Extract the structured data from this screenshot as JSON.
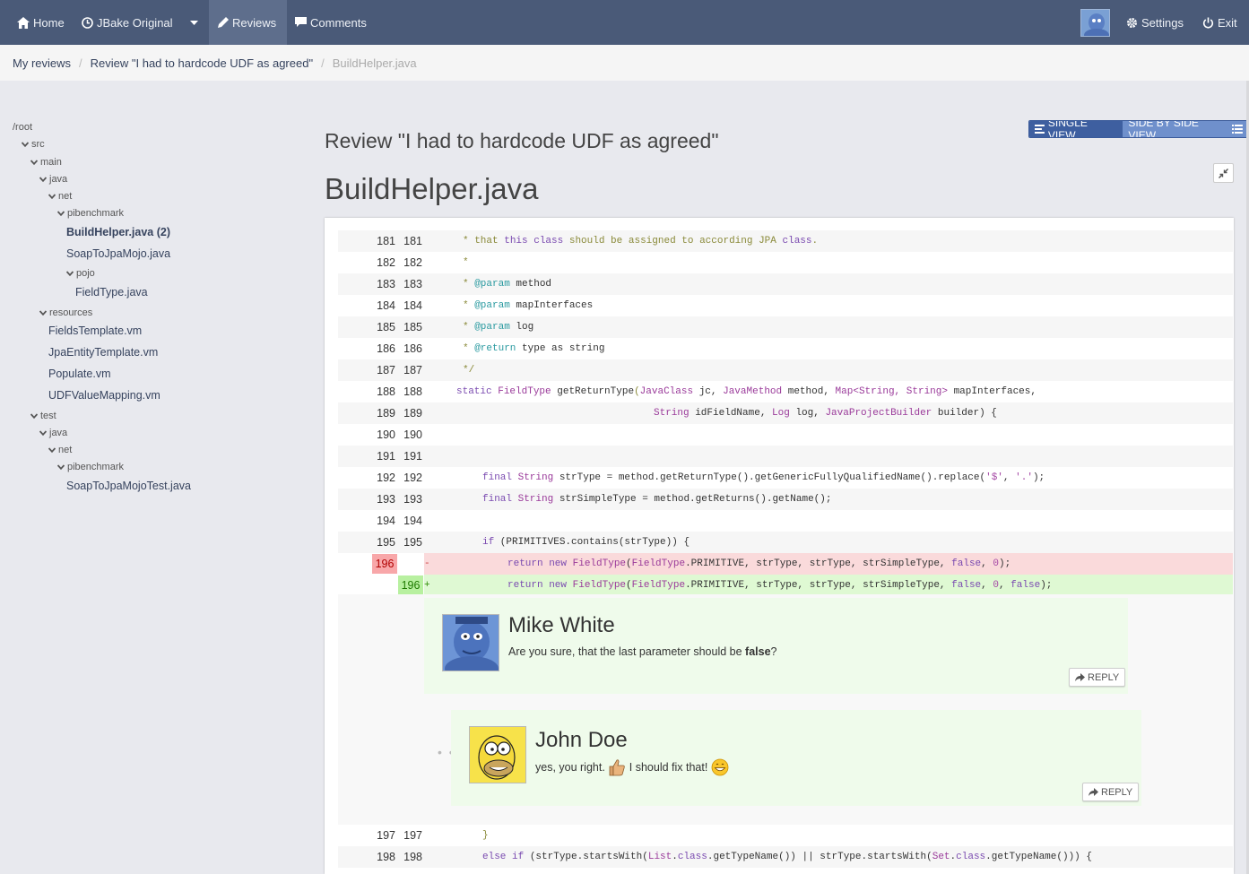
{
  "nav": {
    "home": "Home",
    "project": "JBake Original",
    "reviews": "Reviews",
    "comments": "Comments",
    "settings": "Settings",
    "exit": "Exit"
  },
  "breadcrumb": {
    "my_reviews": "My reviews",
    "review": "Review \"I had to hardcode UDF as agreed\"",
    "file": "BuildHelper.java"
  },
  "tree": {
    "root": "/root",
    "src": "src",
    "main": "main",
    "java": "java",
    "net": "net",
    "pibenchmark": "pibenchmark",
    "build_helper": "BuildHelper.java (2)",
    "soap_to_jpa": "SoapToJpaMojo.java",
    "pojo": "pojo",
    "field_type": "FieldType.java",
    "resources": "resources",
    "fields_template": "FieldsTemplate.vm",
    "jpa_entity": "JpaEntityTemplate.vm",
    "populate": "Populate.vm",
    "udf_value": "UDFValueMapping.vm",
    "test": "test",
    "test_java": "java",
    "test_net": "net",
    "test_pibenchmark": "pibenchmark",
    "soap_test": "SoapToJpaMojoTest.java"
  },
  "main": {
    "review_title": "Review \"I had to hardcode UDF as agreed\"",
    "file_title": "BuildHelper.java",
    "single_view": "SINGLE VIEW",
    "side_view": "SIDE BY SIDE VIEW"
  },
  "lines": [
    {
      "old": "181",
      "new": "181"
    },
    {
      "old": "182",
      "new": "182"
    },
    {
      "old": "183",
      "new": "183"
    },
    {
      "old": "184",
      "new": "184"
    },
    {
      "old": "185",
      "new": "185"
    },
    {
      "old": "186",
      "new": "186"
    },
    {
      "old": "187",
      "new": "187"
    },
    {
      "old": "188",
      "new": "188"
    },
    {
      "old": "189",
      "new": "189"
    },
    {
      "old": "190",
      "new": "190"
    },
    {
      "old": "191",
      "new": "191"
    },
    {
      "old": "192",
      "new": "192"
    },
    {
      "old": "193",
      "new": "193"
    },
    {
      "old": "194",
      "new": "194"
    },
    {
      "old": "195",
      "new": "195"
    },
    {
      "del": "196",
      "marker": "-"
    },
    {
      "add": "196",
      "marker": "+"
    },
    {
      "old": "197",
      "new": "197"
    },
    {
      "old": "198",
      "new": "198"
    }
  ],
  "code": {
    "l181a": "* that ",
    "l181b": "this",
    "l181c": " ",
    "l181d": "class",
    "l181e": " should be assigned to according JPA ",
    "l181f": "class",
    "l181g": ".",
    "l182": "*",
    "l183a": "* ",
    "l183b": "@param",
    "l183c": " method",
    "l184a": "* ",
    "l184b": "@param",
    "l184c": " mapInterfaces",
    "l185a": "* ",
    "l185b": "@param",
    "l185c": " log",
    "l186a": "* ",
    "l186b": "@return",
    "l186c": " type as string",
    "l187": "*/",
    "l188a": "static ",
    "l188b": "FieldType",
    "l188c": " getReturnType",
    "l188d": "(",
    "l188e": "JavaClass",
    "l188f": " jc, ",
    "l188g": "JavaMethod",
    "l188h": " method, ",
    "l188i": "Map<String, String>",
    "l188j": " mapInterfaces,",
    "l189a": "String",
    "l189b": " idFieldName, ",
    "l189c": "Log",
    "l189d": " log, ",
    "l189e": "JavaProjectBuilder",
    "l189f": " builder) {",
    "l192a": "final ",
    "l192b": "String",
    "l192c": " strType = method.getReturnType().getGenericFullyQualifiedName().replace(",
    "l192d": "'$'",
    "l192e": ", ",
    "l192f": "'.'",
    "l192g": ");",
    "l193a": "final ",
    "l193b": "String",
    "l193c": " strSimpleType = method.getReturns().getName();",
    "l195a": "if",
    "l195b": " (PRIMITIVES.contains(strType)) {",
    "l196da": "return new ",
    "l196db": "FieldType",
    "l196dc": "(",
    "l196dd": "FieldType",
    "l196de": ".PRIMITIVE, strType, strType, strSimpleType, ",
    "l196df": "false",
    "l196dg": ", ",
    "l196dh": "0",
    "l196di": ");",
    "l196aa": "return new ",
    "l196ab": "FieldType",
    "l196ac": "(",
    "l196ad": "FieldType",
    "l196ae": ".PRIMITIVE, strType, strType, strSimpleType, ",
    "l196af": "false",
    "l196ag": ", ",
    "l196ah": "0",
    "l196ai": ", ",
    "l196aj": "false",
    "l196ak": ");",
    "l197": "}",
    "l198a": "else if",
    "l198b": " (strType.startsWith(",
    "l198c": "List",
    "l198d": ".",
    "l198e": "class",
    "l198f": ".getTypeName()) || strType.startsWith(",
    "l198g": "Set",
    "l198h": ".",
    "l198i": "class",
    "l198j": ".getTypeName())) {"
  },
  "comments": [
    {
      "author": "Mike White",
      "text_before": "Are you sure, that the last parameter should be ",
      "text_bold": "false",
      "text_after": "?",
      "reply": "REPLY"
    },
    {
      "author": "John Doe",
      "text_before": "yes, you right. ",
      "text_middle": " I should fix that! ",
      "reply": "REPLY"
    }
  ],
  "colors": {
    "topbar": "#4a5a78",
    "deleted_line": "#fadadb",
    "added_line": "#dff9d3",
    "comment_bg": "#effbeb"
  },
  "icons": [
    "home-icon",
    "clock-icon",
    "caret-down-icon",
    "pencil-icon",
    "comment-icon",
    "gear-icon",
    "power-icon",
    "align-left-icon",
    "list-icon",
    "compress-icon",
    "reply-icon",
    "chevron-down-icon",
    "thumbs-up-emoji",
    "grin-emoji"
  ]
}
